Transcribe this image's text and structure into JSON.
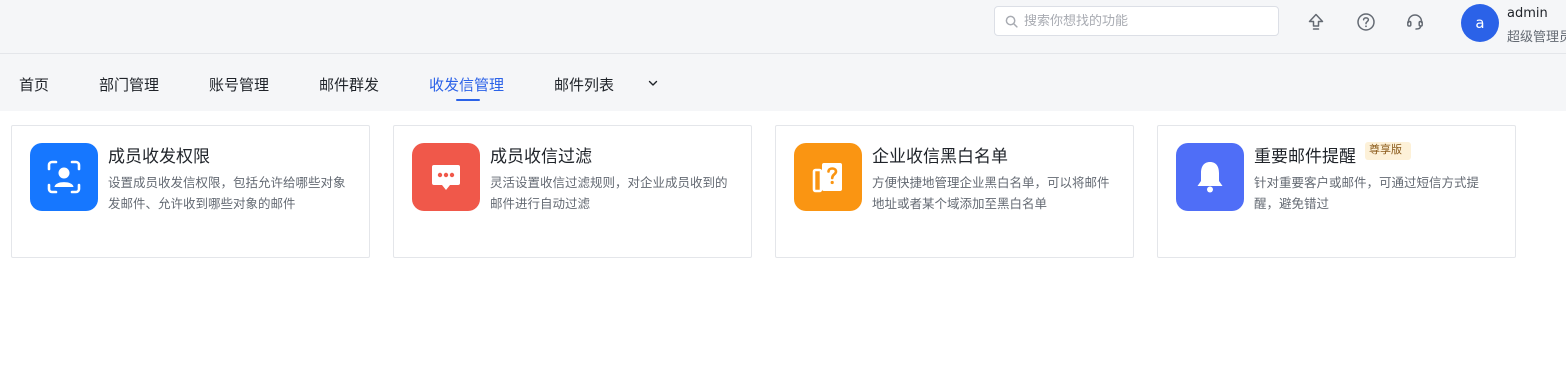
{
  "header": {
    "search": {
      "placeholder": "搜索你想找的功能",
      "value": ""
    },
    "icons": [
      "upload-icon",
      "help-icon",
      "headset-icon"
    ],
    "user": {
      "avatar_letter": "a",
      "name": "admin",
      "role": "超级管理员"
    }
  },
  "tabs": [
    {
      "label": "首页",
      "active": false
    },
    {
      "label": "部门管理",
      "active": false
    },
    {
      "label": "账号管理",
      "active": false
    },
    {
      "label": "邮件群发",
      "active": false
    },
    {
      "label": "收发信管理",
      "active": true
    },
    {
      "label": "邮件列表",
      "active": false
    }
  ],
  "cards": [
    {
      "title": "成员收发权限",
      "desc": "设置成员收发信权限，包括允许给哪些对象发邮件、允许收到哪些对象的邮件",
      "icon": "member-permission-icon",
      "color": "#1677ff"
    },
    {
      "title": "成员收信过滤",
      "desc": "灵活设置收信过滤规则，对企业成员收到的邮件进行自动过滤",
      "icon": "chat-filter-icon",
      "color": "#f0584a"
    },
    {
      "title": "企业收信黑白名单",
      "desc": "方便快捷地管理企业黑白名单，可以将邮件地址或者某个域添加至黑白名单",
      "icon": "question-list-icon",
      "color": "#fa9512"
    },
    {
      "title": "重要邮件提醒",
      "badge": "尊享版",
      "desc": "针对重要客户或邮件，可通过短信方式提醒，避免错过",
      "icon": "bell-icon",
      "color": "#4f6ef7"
    }
  ]
}
